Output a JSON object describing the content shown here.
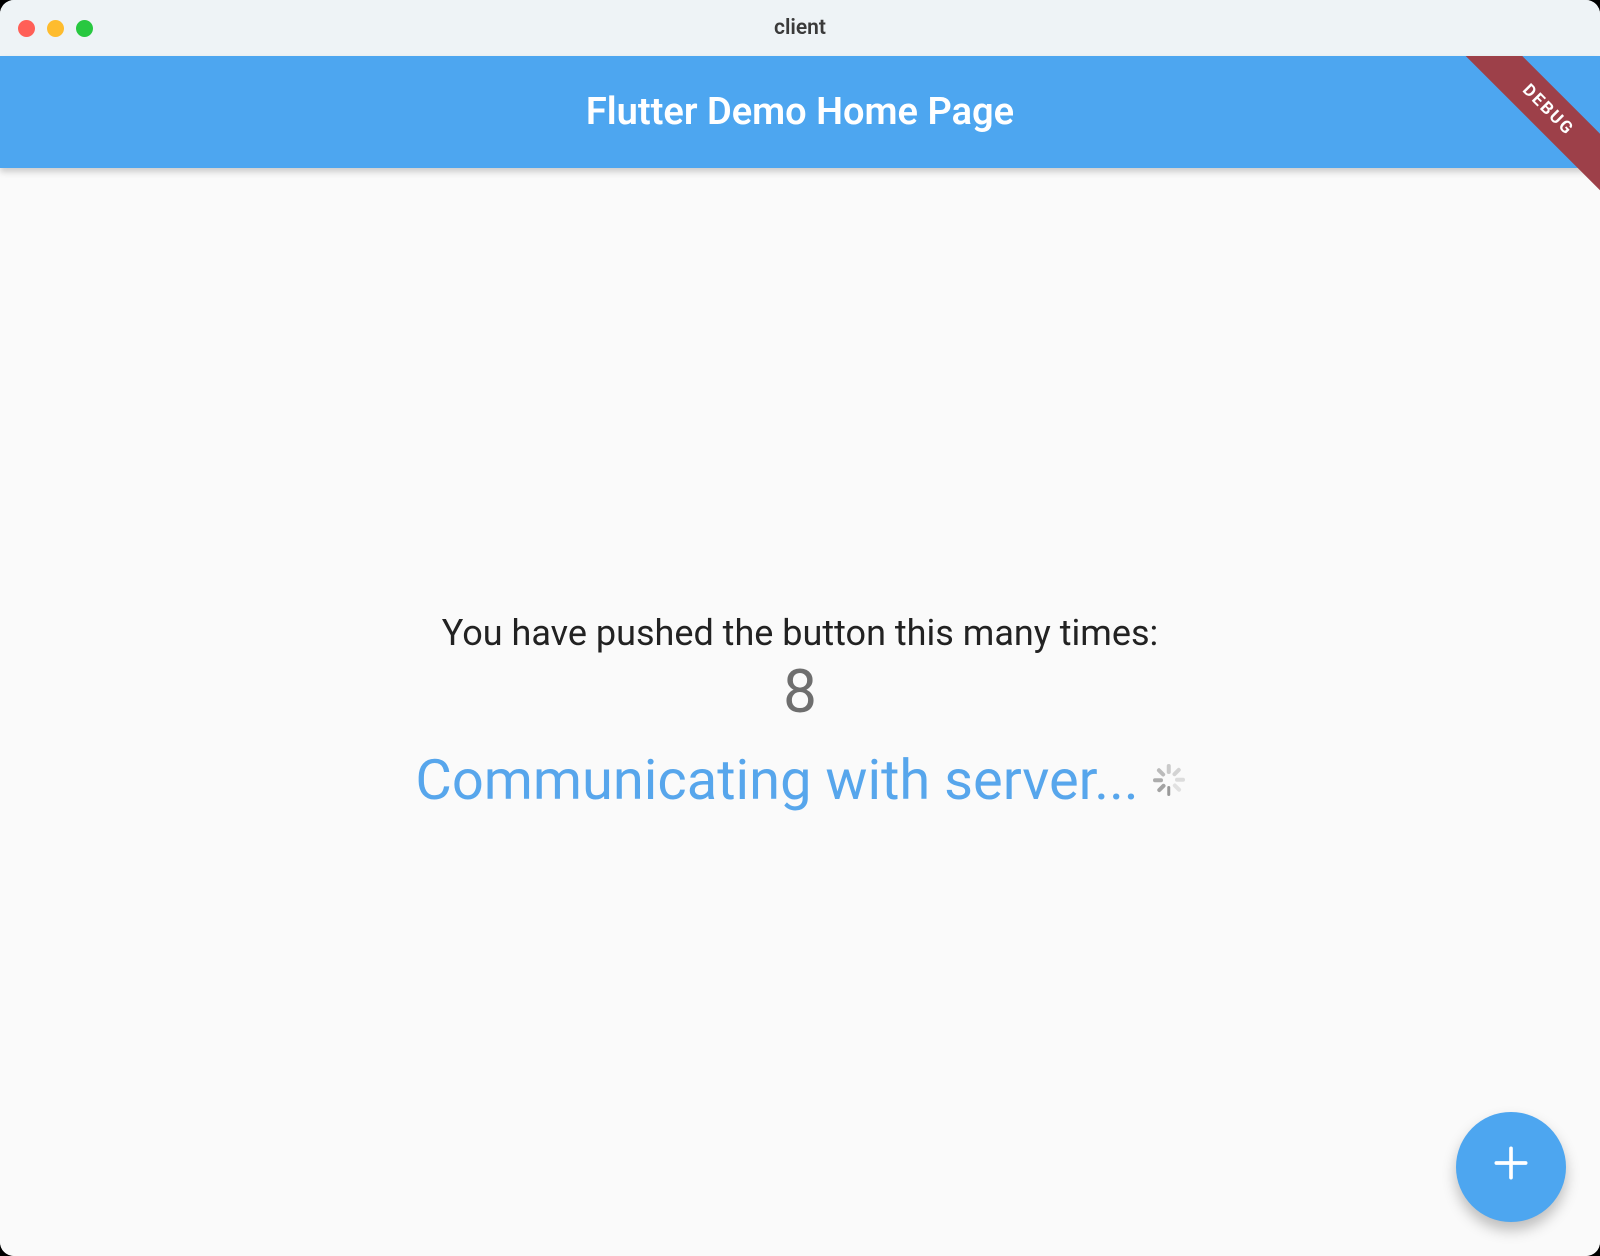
{
  "window": {
    "title": "client"
  },
  "appbar": {
    "title": "Flutter Demo Home Page"
  },
  "debug": {
    "label": "DEBUG"
  },
  "body": {
    "push_text": "You have pushed the button this many times:",
    "counter": "8",
    "status_text": "Communicating with server..."
  },
  "fab": {
    "icon": "plus-icon"
  },
  "colors": {
    "primary": "#4da6f0",
    "accent_text": "#57a6ec",
    "debug_banner": "#9d4049"
  }
}
